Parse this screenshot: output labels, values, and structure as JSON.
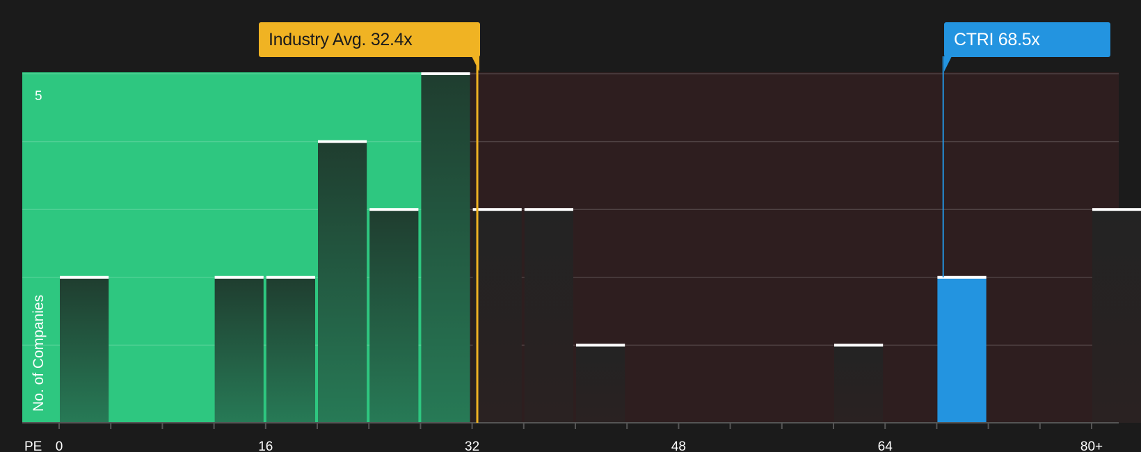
{
  "chart_data": {
    "type": "bar",
    "xlabel": "PE",
    "ylabel": "No. of Companies",
    "x_tick_labels": [
      "0",
      "16",
      "32",
      "48",
      "64",
      "80+"
    ],
    "x_tick_values": [
      0,
      16,
      32,
      48,
      64,
      80
    ],
    "y_tick_labels": [
      "5"
    ],
    "ylim": [
      0,
      5
    ],
    "xlim": [
      -3,
      82
    ],
    "bin_width": 4,
    "bins": [
      {
        "start": 0,
        "count": 2
      },
      {
        "start": 4,
        "count": 0
      },
      {
        "start": 8,
        "count": 0
      },
      {
        "start": 12,
        "count": 2
      },
      {
        "start": 16,
        "count": 2
      },
      {
        "start": 20,
        "count": 4
      },
      {
        "start": 24,
        "count": 3
      },
      {
        "start": 28,
        "count": 5
      },
      {
        "start": 32,
        "count": 3
      },
      {
        "start": 36,
        "count": 3
      },
      {
        "start": 40,
        "count": 1
      },
      {
        "start": 44,
        "count": 0
      },
      {
        "start": 48,
        "count": 0
      },
      {
        "start": 52,
        "count": 0
      },
      {
        "start": 56,
        "count": 0
      },
      {
        "start": 60,
        "count": 1
      },
      {
        "start": 64,
        "count": 0
      },
      {
        "start": 68,
        "count": 2
      },
      {
        "start": 72,
        "count": 0
      },
      {
        "start": 76,
        "count": 0
      },
      {
        "start": 80,
        "count": 3
      }
    ],
    "highlight_bin_start": 68,
    "industry_avg": {
      "label": "Industry Avg. 32.4x",
      "value": 32.4
    },
    "company": {
      "label": "CTRI 68.5x",
      "value": 68.5
    },
    "grid": true
  },
  "colors": {
    "background": "#1b1b1b",
    "below_avg_region": "#2ec780",
    "above_avg_region": "#2e1e1f",
    "bar_dark": "#1f3d2f",
    "bar_above": "#272222",
    "bar_top": "#ffffff",
    "industry_accent": "#f0b323",
    "company_accent": "#2394e0"
  }
}
